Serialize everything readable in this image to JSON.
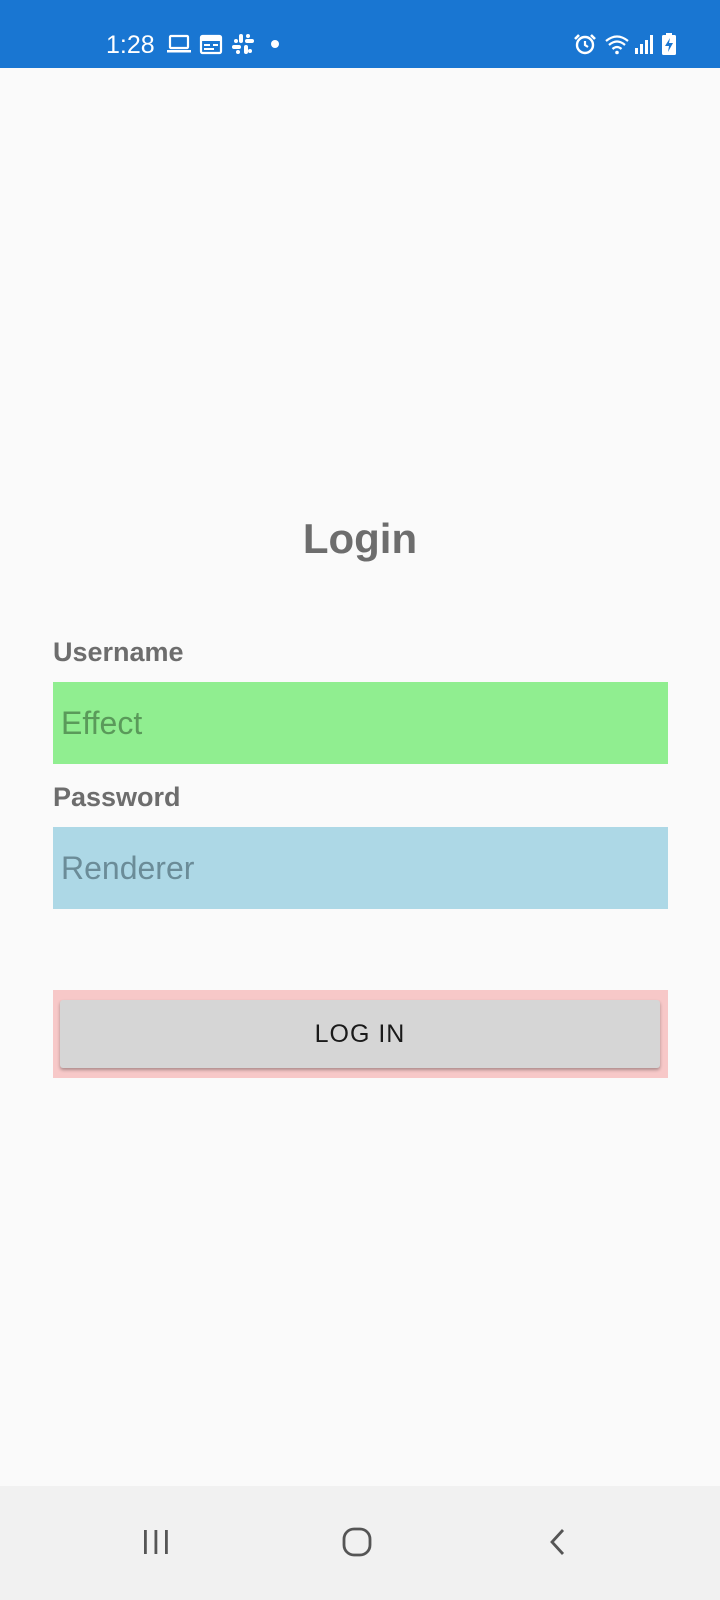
{
  "status_bar": {
    "time": "1:28",
    "background_color": "#1976d2",
    "left_icons": [
      "laptop-icon",
      "calendar-icon",
      "slack-icon",
      "notification-dot-icon"
    ],
    "right_icons": [
      "alarm-icon",
      "wifi-icon",
      "signal-icon",
      "battery-charging-icon"
    ]
  },
  "login": {
    "title": "Login",
    "username": {
      "label": "Username",
      "placeholder": "Effect",
      "background_color": "#90ee90"
    },
    "password": {
      "label": "Password",
      "placeholder": "Renderer",
      "background_color": "#add8e6"
    },
    "button": {
      "label": "LOG IN",
      "frame_color": "#f7c8c8",
      "background_color": "#d6d6d6"
    }
  },
  "nav_bar": {
    "icons": [
      "recents-icon",
      "home-icon",
      "back-icon"
    ]
  }
}
